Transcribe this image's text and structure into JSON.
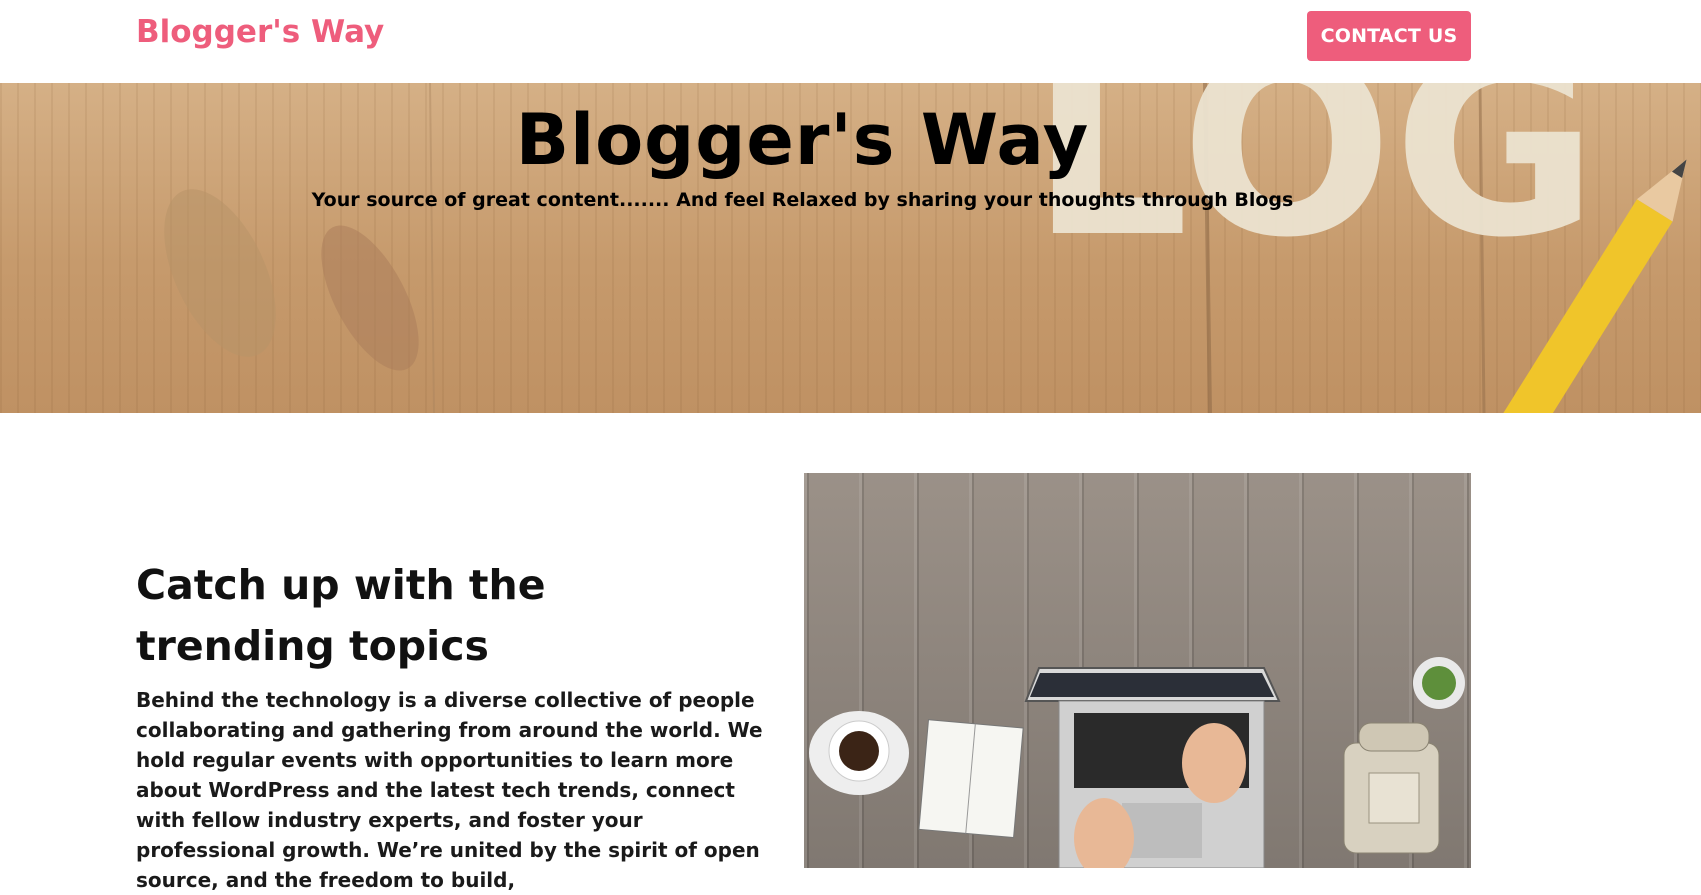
{
  "nav": {
    "brand": "Blogger's Way",
    "contact_label": "CONTACT US"
  },
  "hero": {
    "title": "Blogger's Way",
    "subtitle": "Your source of great content....... And feel Relaxed by sharing your thoughts through Blogs",
    "background_letters": "LOG"
  },
  "content": {
    "heading": "Catch up with the trending topics",
    "body": "Behind the technology is a diverse collective of people collaborating and gathering from around the world. We hold regular events with opportunities to learn more about WordPress and the latest tech trends, connect with fellow industry experts, and foster your professional growth. We’re united by the spirit of open source, and the freedom to build,"
  },
  "colors": {
    "accent": "#ee5d7c",
    "text": "#111111",
    "background": "#ffffff"
  }
}
